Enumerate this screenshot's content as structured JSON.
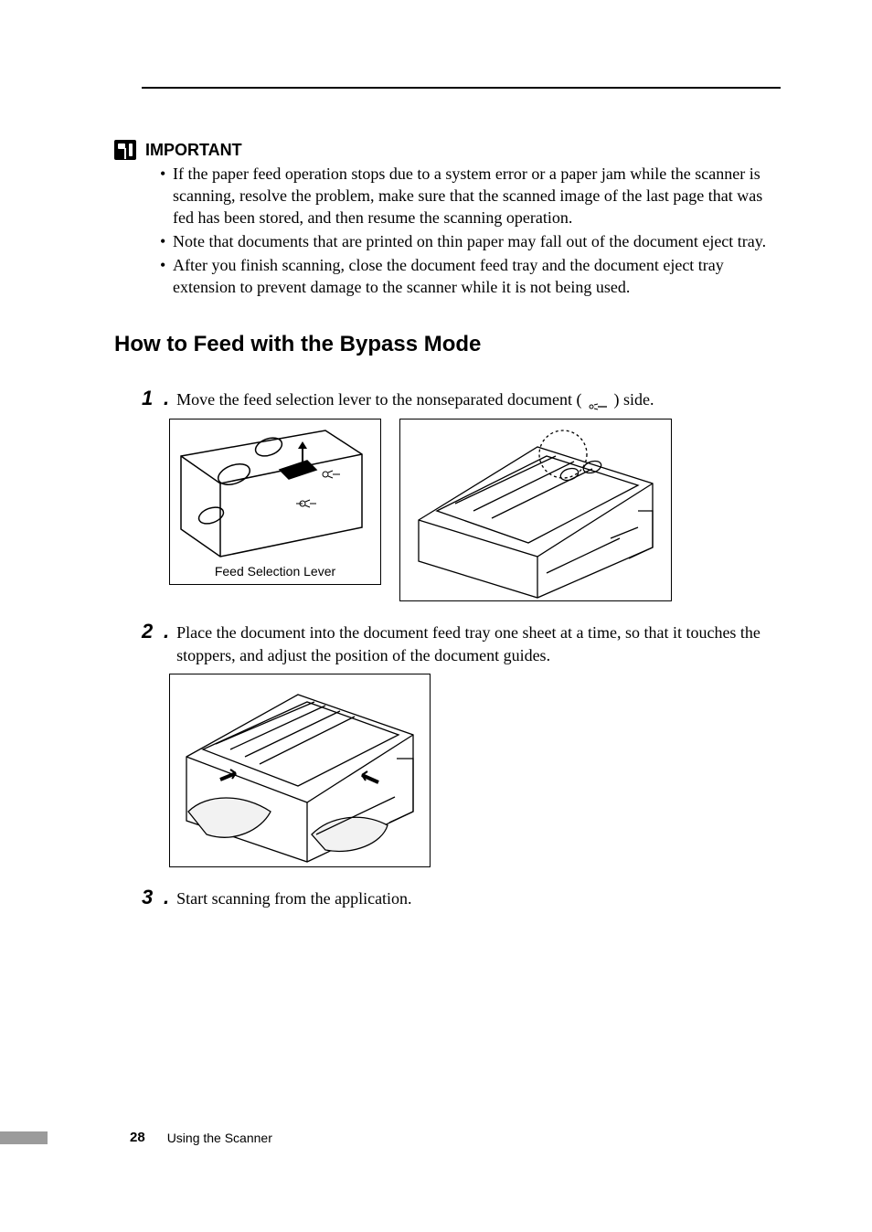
{
  "important": {
    "label": "IMPORTANT",
    "bullets": [
      "If the paper feed operation stops due to a system error or a paper jam while the scanner is scanning, resolve the problem, make sure that the scanned image of the last page that was fed has been stored, and then resume the scanning operation.",
      "Note that documents that are printed on thin paper may fall out of the document eject tray.",
      "After you finish scanning, close the document feed tray and the document eject tray extension to prevent damage to the scanner while it is not being used."
    ]
  },
  "section_title": "How to Feed with the Bypass Mode",
  "steps": {
    "s1": {
      "num": "1",
      "text_a": "Move the feed selection lever to the nonseparated document (",
      "text_b": ") side.",
      "fig_caption": "Feed Selection Lever"
    },
    "s2": {
      "num": "2",
      "text": "Place the document into the document feed tray one sheet at a time, so that it touches the stoppers, and adjust the position of the document guides."
    },
    "s3": {
      "num": "3",
      "text": "Start scanning from the application."
    }
  },
  "footer": {
    "page": "28",
    "label": "Using the Scanner"
  }
}
